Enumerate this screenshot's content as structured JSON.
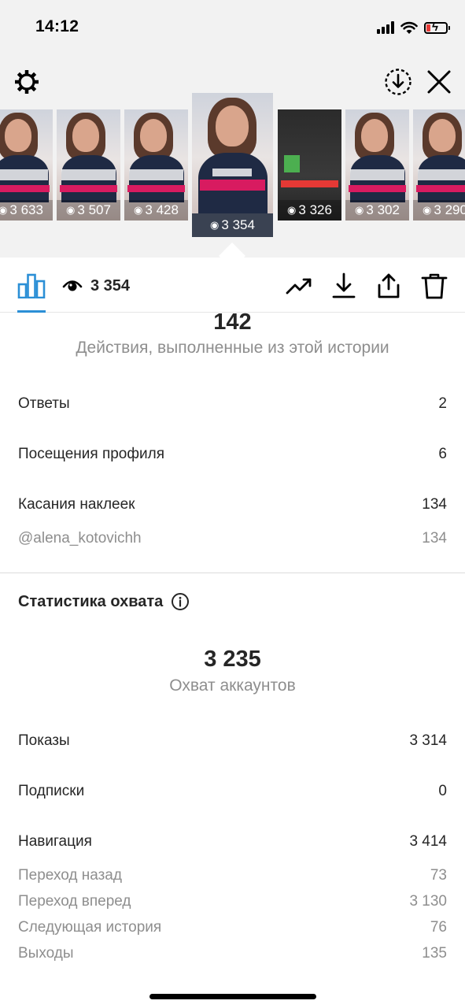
{
  "status_bar": {
    "time": "14:12"
  },
  "thumbnails": [
    {
      "views": "3 633",
      "dark": false
    },
    {
      "views": "3 507",
      "dark": false
    },
    {
      "views": "3 428",
      "dark": false
    },
    {
      "views": "3 354",
      "dark": false,
      "selected": true
    },
    {
      "views": "3 326",
      "dark": true
    },
    {
      "views": "3 302",
      "dark": false
    },
    {
      "views": "3 290",
      "dark": false
    }
  ],
  "toolbar": {
    "views": "3 354"
  },
  "interactions": {
    "total": "142",
    "label": "Действия, выполненные из этой истории",
    "rows": [
      {
        "label": "Ответы",
        "value": "2"
      },
      {
        "label": "Посещения профиля",
        "value": "6"
      },
      {
        "label": "Касания наклеек",
        "value": "134"
      },
      {
        "label": "@alena_kotovichh",
        "value": "134",
        "sub": true
      }
    ]
  },
  "reach": {
    "title": "Статистика охвата",
    "total": "3 235",
    "label": "Охват аккаунтов",
    "rows": [
      {
        "label": "Показы",
        "value": "3 314"
      },
      {
        "label": "Подписки",
        "value": "0"
      },
      {
        "label": "Навигация",
        "value": "3 414"
      },
      {
        "label": "Переход назад",
        "value": "73",
        "sub": true
      },
      {
        "label": "Переход вперед",
        "value": "3 130",
        "sub": true
      },
      {
        "label": "Следующая история",
        "value": "76",
        "sub": true
      },
      {
        "label": "Выходы",
        "value": "135",
        "sub": true
      }
    ]
  },
  "colors": {
    "accent": "#2b8fd6",
    "battery_low": "#e53935",
    "muted_text": "#8e8e8e"
  }
}
